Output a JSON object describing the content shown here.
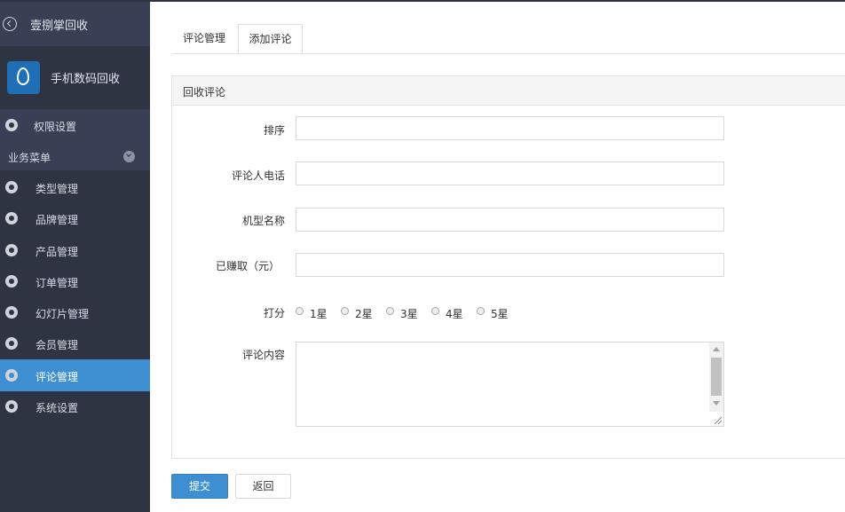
{
  "sidebar": {
    "app_title": "壹捌掌回收",
    "brand_name": "手机数码回收",
    "permission_item": "权限设置",
    "group_label": "业务菜单",
    "items": [
      {
        "label": "类型管理"
      },
      {
        "label": "品牌管理"
      },
      {
        "label": "产品管理"
      },
      {
        "label": "订单管理"
      },
      {
        "label": "幻灯片管理"
      },
      {
        "label": "会员管理"
      },
      {
        "label": "评论管理",
        "active": true
      },
      {
        "label": "系统设置"
      }
    ]
  },
  "tabs": [
    {
      "label": "评论管理"
    },
    {
      "label": "添加评论",
      "active": true
    }
  ],
  "panel": {
    "title": "回收评论",
    "fields": {
      "sort": {
        "label": "排序",
        "value": ""
      },
      "phone": {
        "label": "评论人电话",
        "value": ""
      },
      "model": {
        "label": "机型名称",
        "value": ""
      },
      "earned": {
        "label": "已赚取（元）",
        "value": ""
      },
      "rating": {
        "label": "打分",
        "options": [
          "1星",
          "2星",
          "3星",
          "4星",
          "5星"
        ]
      },
      "content": {
        "label": "评论内容",
        "value": ""
      }
    }
  },
  "buttons": {
    "submit": "提交",
    "back": "返回"
  },
  "colors": {
    "sidebar_bg": "#2f3442",
    "accent": "#3d8fd1"
  }
}
